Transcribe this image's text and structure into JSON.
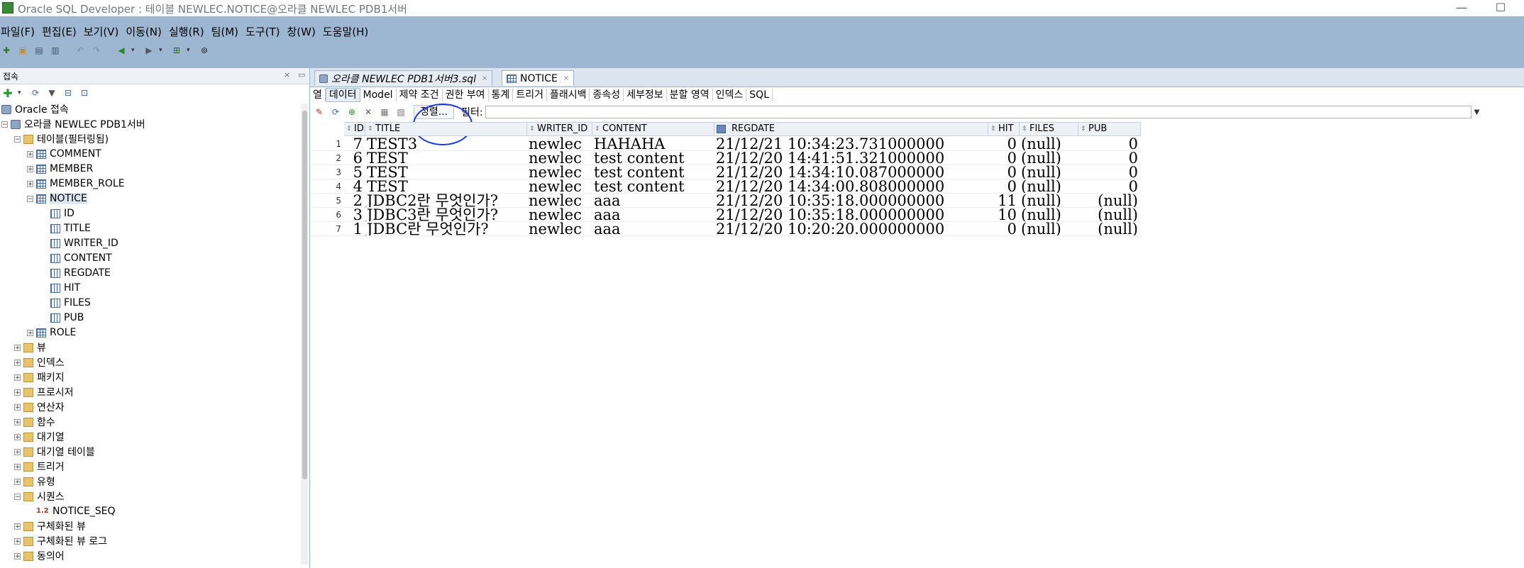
{
  "window": {
    "title": "Oracle SQL Developer : 테이블 NEWLEC.NOTICE@오라클 NEWLEC PDB1서버",
    "minimize": "—",
    "maximize": "☐"
  },
  "menu": [
    "파일(F)",
    "편집(E)",
    "보기(V)",
    "이동(N)",
    "실행(R)",
    "팀(M)",
    "도구(T)",
    "창(W)",
    "도움말(H)"
  ],
  "left_panel": {
    "title": "접속",
    "close": "×",
    "tree": [
      {
        "label": "Oracle 접속",
        "level": 0,
        "icon": "db",
        "exp": ""
      },
      {
        "label": "오라클 NEWLEC PDB1서버",
        "level": 0,
        "icon": "db",
        "exp": "−"
      },
      {
        "label": "테이블(필터링됨)",
        "level": 1,
        "icon": "folder",
        "exp": "−"
      },
      {
        "label": "COMMENT",
        "level": 2,
        "icon": "table",
        "exp": "+"
      },
      {
        "label": "MEMBER",
        "level": 2,
        "icon": "table",
        "exp": "+"
      },
      {
        "label": "MEMBER_ROLE",
        "level": 2,
        "icon": "table",
        "exp": "+"
      },
      {
        "label": "NOTICE",
        "level": 2,
        "icon": "table",
        "exp": "−",
        "selected": true
      },
      {
        "label": "ID",
        "level": 3,
        "icon": "col",
        "exp": ""
      },
      {
        "label": "TITLE",
        "level": 3,
        "icon": "col",
        "exp": ""
      },
      {
        "label": "WRITER_ID",
        "level": 3,
        "icon": "col",
        "exp": ""
      },
      {
        "label": "CONTENT",
        "level": 3,
        "icon": "col",
        "exp": ""
      },
      {
        "label": "REGDATE",
        "level": 3,
        "icon": "col",
        "exp": ""
      },
      {
        "label": "HIT",
        "level": 3,
        "icon": "col",
        "exp": ""
      },
      {
        "label": "FILES",
        "level": 3,
        "icon": "col",
        "exp": ""
      },
      {
        "label": "PUB",
        "level": 3,
        "icon": "col",
        "exp": ""
      },
      {
        "label": "ROLE",
        "level": 2,
        "icon": "table",
        "exp": "+"
      },
      {
        "label": "뷰",
        "level": 1,
        "icon": "folder",
        "exp": "+"
      },
      {
        "label": "인덱스",
        "level": 1,
        "icon": "folder",
        "exp": "+"
      },
      {
        "label": "패키지",
        "level": 1,
        "icon": "folder",
        "exp": "+"
      },
      {
        "label": "프로시저",
        "level": 1,
        "icon": "folder",
        "exp": "+"
      },
      {
        "label": "연산자",
        "level": 1,
        "icon": "folder",
        "exp": "+"
      },
      {
        "label": "함수",
        "level": 1,
        "icon": "folder",
        "exp": "+"
      },
      {
        "label": "대기열",
        "level": 1,
        "icon": "folder",
        "exp": "+"
      },
      {
        "label": "대기열 테이블",
        "level": 1,
        "icon": "folder",
        "exp": "+"
      },
      {
        "label": "트리거",
        "level": 1,
        "icon": "folder",
        "exp": "+"
      },
      {
        "label": "유형",
        "level": 1,
        "icon": "folder",
        "exp": "+"
      },
      {
        "label": "시퀀스",
        "level": 1,
        "icon": "folder",
        "exp": "−"
      },
      {
        "label": "NOTICE_SEQ",
        "level": 2,
        "icon": "seq",
        "exp": ""
      },
      {
        "label": "구체화된 뷰",
        "level": 1,
        "icon": "folder",
        "exp": "+"
      },
      {
        "label": "구체화된 뷰 로그",
        "level": 1,
        "icon": "folder",
        "exp": "+"
      },
      {
        "label": "동의어",
        "level": 1,
        "icon": "folder",
        "exp": "+"
      }
    ]
  },
  "tabs": [
    {
      "label": "오라클 NEWLEC PDB1서버3.sql",
      "close": "×"
    },
    {
      "label": "NOTICE",
      "close": "×"
    }
  ],
  "subtabs": [
    "열",
    "데이터",
    "Model",
    "제약 조건",
    "권한 부여",
    "통계",
    "트리거",
    "플래시백",
    "종속성",
    "세부정보",
    "분할 영역",
    "인덱스",
    "SQL"
  ],
  "grid_toolbar": {
    "sort_label": "정렬...",
    "filter_label": "필터:",
    "filter_value": ""
  },
  "table": {
    "columns": [
      "ID",
      "TITLE",
      "WRITER_ID",
      "CONTENT",
      "REGDATE",
      "HIT",
      "FILES",
      "PUB"
    ],
    "rows": [
      [
        "1",
        "7",
        "TEST3",
        "newlec",
        "HAHAHA",
        "21/12/21 10:34:23.731000000",
        "0",
        "(null)",
        "0"
      ],
      [
        "2",
        "6",
        "TEST",
        "newlec",
        "test content",
        "21/12/20 14:41:51.321000000",
        "0",
        "(null)",
        "0"
      ],
      [
        "3",
        "5",
        "TEST",
        "newlec",
        "test content",
        "21/12/20 14:34:10.087000000",
        "0",
        "(null)",
        "0"
      ],
      [
        "4",
        "4",
        "TEST",
        "newlec",
        "test content",
        "21/12/20 14:34:00.808000000",
        "0",
        "(null)",
        "0"
      ],
      [
        "5",
        "2",
        "JDBC2란 무엇인가?",
        "newlec",
        "aaa",
        "21/12/20 10:35:18.000000000",
        "11",
        "(null)",
        "(null)"
      ],
      [
        "6",
        "3",
        "JDBC3란 무엇인가?",
        "newlec",
        "aaa",
        "21/12/20 10:35:18.000000000",
        "10",
        "(null)",
        "(null)"
      ],
      [
        "7",
        "1",
        "JDBC란 무엇인가?",
        "newlec",
        "aaa",
        "21/12/20 10:20:20.000000000",
        "0",
        "(null)",
        "(null)"
      ]
    ]
  },
  "colors": {
    "chrome": "#9db6d2",
    "annotation": "#1a3ae0"
  }
}
